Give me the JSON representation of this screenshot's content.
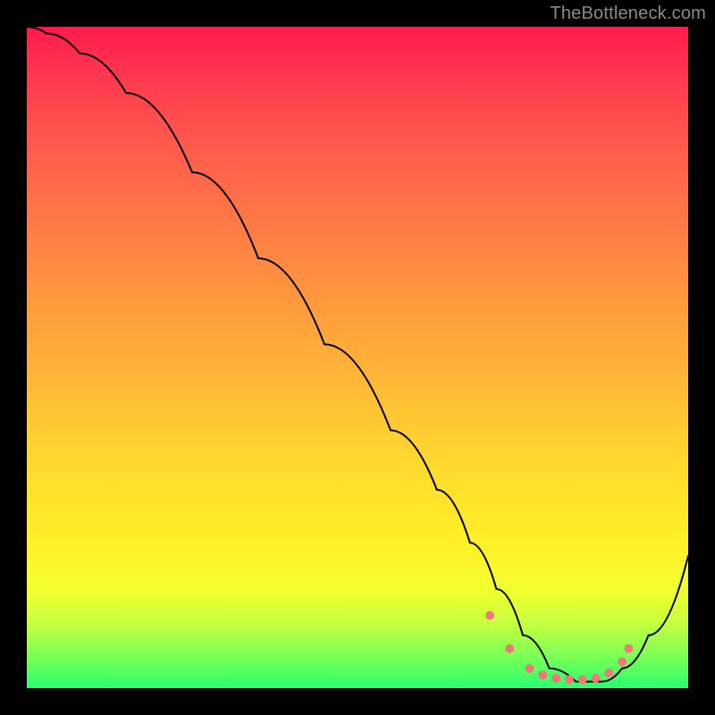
{
  "watermark": "TheBottleneck.com",
  "chart_data": {
    "type": "line",
    "title": "",
    "xlabel": "",
    "ylabel": "",
    "xlim": [
      0,
      100
    ],
    "ylim": [
      0,
      100
    ],
    "grid": false,
    "legend": false,
    "background": "vertical-gradient",
    "gradient_stops": [
      {
        "pos": 0.0,
        "color": "#ff1a4d"
      },
      {
        "pos": 0.3,
        "color": "#ff7a45"
      },
      {
        "pos": 0.66,
        "color": "#ffd92e"
      },
      {
        "pos": 0.9,
        "color": "#c8ff3e"
      },
      {
        "pos": 1.0,
        "color": "#2aff70"
      }
    ],
    "series": [
      {
        "name": "bottleneck-curve",
        "color": "#000000",
        "stroke_width": 2,
        "x": [
          0,
          3,
          8,
          15,
          25,
          35,
          45,
          55,
          62,
          67,
          71,
          75,
          79,
          83,
          87,
          90,
          94,
          100
        ],
        "y": [
          100,
          99,
          96,
          90,
          78,
          65,
          52,
          39,
          30,
          22,
          15,
          8,
          3,
          1,
          1,
          3,
          8,
          20
        ]
      }
    ],
    "markers": {
      "name": "optimal-range-dots",
      "color": "#f07878",
      "radius": 5,
      "points": [
        {
          "x": 70,
          "y": 11
        },
        {
          "x": 73,
          "y": 6
        },
        {
          "x": 76,
          "y": 3
        },
        {
          "x": 78,
          "y": 2
        },
        {
          "x": 80,
          "y": 1.5
        },
        {
          "x": 82,
          "y": 1.3
        },
        {
          "x": 84,
          "y": 1.3
        },
        {
          "x": 86,
          "y": 1.5
        },
        {
          "x": 88,
          "y": 2.3
        },
        {
          "x": 90,
          "y": 4
        },
        {
          "x": 91,
          "y": 6
        }
      ]
    }
  }
}
